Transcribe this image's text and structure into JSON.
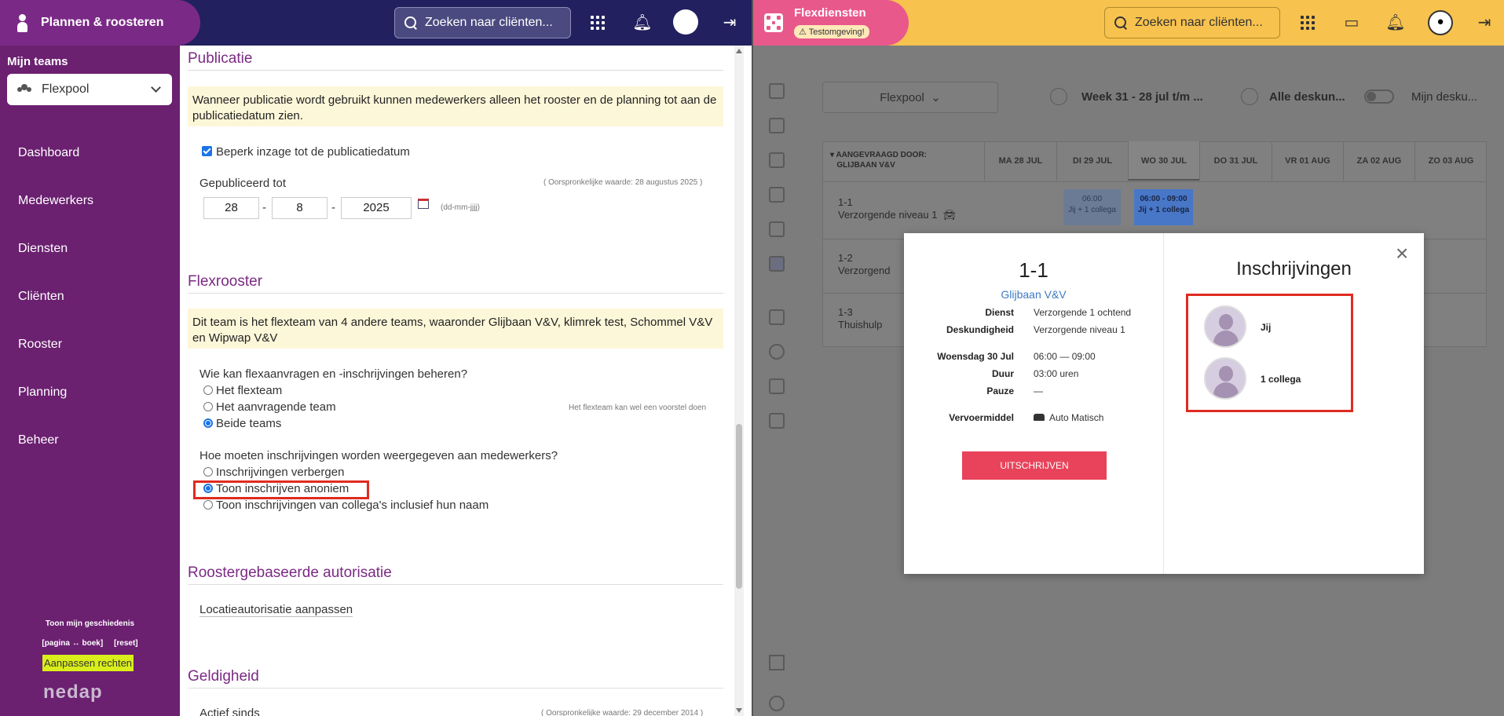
{
  "left": {
    "app_title": "Plannen & roosteren",
    "search_placeholder": "Zoeken naar cliënten...",
    "sidebar": {
      "teams_label": "Mijn teams",
      "team_selected": "Flexpool",
      "items": [
        {
          "label": "Dashboard"
        },
        {
          "label": "Medewerkers"
        },
        {
          "label": "Diensten"
        },
        {
          "label": "Cliënten"
        },
        {
          "label": "Rooster"
        },
        {
          "label": "Planning"
        },
        {
          "label": "Beheer"
        }
      ],
      "history_link": "Toon mijn geschiedenis",
      "page_book": "[pagina ↔ boek]",
      "reset": "[reset]",
      "aanpassen": "Aanpassen rechten",
      "logo": "nedap"
    },
    "content": {
      "publicatie_title": "Publicatie",
      "publicatie_notice": "Wanneer publicatie wordt gebruikt kunnen medewerkers alleen het rooster en de planning tot aan de publicatiedatum zien.",
      "beperk_label": "Beperk inzage tot de publicatiedatum",
      "gepubliceerd_label": "Gepubliceerd tot",
      "original_value": "( Oorspronkelijke waarde: 28 augustus 2025 )",
      "date_day": "28",
      "date_month": "8",
      "date_year": "2025",
      "dash": "-",
      "date_format": "(dd-mm-jjjj)",
      "flexrooster_title": "Flexrooster",
      "flexrooster_notice": "Dit team is het flexteam van 4 andere teams, waaronder Glijbaan V&V, klimrek test, Schommel V&V en Wipwap V&V",
      "beheren_question": "Wie kan flexaanvragen en -inschrijvingen beheren?",
      "beheren_options": [
        "Het flexteam",
        "Het aanvragende team",
        "Beide teams"
      ],
      "beheren_hint": "Het flexteam kan wel een voorstel doen",
      "weergave_question": "Hoe moeten inschrijvingen worden weergegeven aan medewerkers?",
      "weergave_options": [
        "Inschrijvingen verbergen",
        "Toon inschrijven anoniem",
        "Toon inschrijvingen van collega's inclusief hun naam"
      ],
      "rooster_auth_title": "Roostergebaseerde autorisatie",
      "locatie_link": "Locatieautorisatie aanpassen",
      "geldigheid_title": "Geldigheid",
      "actief_sinds": "Actief sinds",
      "original_value_2": "( Oorspronkelijke waarde: 29 december 2014 )"
    }
  },
  "right": {
    "app_title": "Flexdiensten",
    "test_badge": "Testomgeving!",
    "search_placeholder": "Zoeken naar cliënten...",
    "team_select": "Flexpool",
    "week_label": "Week 31 - 28 jul t/m ...",
    "alle_desk": "Alle deskun...",
    "mijn_desk": "Mijn desku...",
    "table": {
      "header_requested_by": "AANGEVRAAGD DOOR:",
      "header_team": "GLIJBAAN V&V",
      "days": [
        "MA 28 JUL",
        "DI 29 JUL",
        "WO 30 JUL",
        "DO 31 JUL",
        "VR 01 AUG",
        "ZA 02 AUG",
        "ZO 03 AUG"
      ],
      "rows": [
        {
          "code": "1-1",
          "desc": "Verzorgende niveau 1"
        },
        {
          "code": "1-2",
          "desc": "Verzorgend"
        },
        {
          "code": "1-3",
          "desc": "Thuishulp"
        }
      ],
      "shift_di": {
        "time": "06:00",
        "sub": "Jij + 1 collega"
      },
      "shift_wo": {
        "time": "06:00 - 09:00",
        "sub": "Jij + 1 collega"
      }
    },
    "modal": {
      "title": "1-1",
      "team": "Glijbaan V&V",
      "dienst_label": "Dienst",
      "dienst_value": "Verzorgende 1 ochtend",
      "desk_label": "Deskundigheid",
      "desk_value": "Verzorgende niveau 1",
      "date_label": "Woensdag 30 Jul",
      "time_value": "06:00  —  09:00",
      "duur_label": "Duur",
      "duur_value": "03:00 uren",
      "pauze_label": "Pauze",
      "pauze_value": "—",
      "vervoer_label": "Vervoermiddel",
      "vervoer_value": "Auto Matisch",
      "button": "UITSCHRIJVEN",
      "close": "×",
      "inschrijvingen_title": "Inschrijvingen",
      "registrations": [
        {
          "name": "Jij"
        },
        {
          "name": "1 collega"
        }
      ]
    }
  }
}
